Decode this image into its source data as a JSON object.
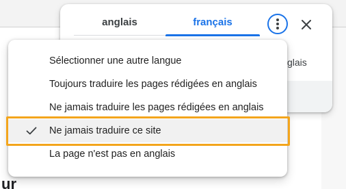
{
  "background": {
    "heading_fragment": "ur"
  },
  "translate_popup": {
    "tabs": [
      {
        "label": "anglais",
        "active": false
      },
      {
        "label": "français",
        "active": true
      }
    ],
    "more_icon": "more-vert-icon",
    "close_icon": "close-icon",
    "body_text_fragment": "glais",
    "accent_color": "#1a73e8"
  },
  "menu": {
    "items": [
      {
        "label": "Sélectionner une autre langue",
        "checked": false
      },
      {
        "label": "Toujours traduire les pages rédigées en anglais",
        "checked": false
      },
      {
        "label": "Ne jamais traduire les pages rédigées en anglais",
        "checked": false
      },
      {
        "label": "Ne jamais traduire ce site",
        "checked": true
      },
      {
        "label": "La page n'est pas en anglais",
        "checked": false
      }
    ],
    "highlight_color": "#f3a51c"
  }
}
